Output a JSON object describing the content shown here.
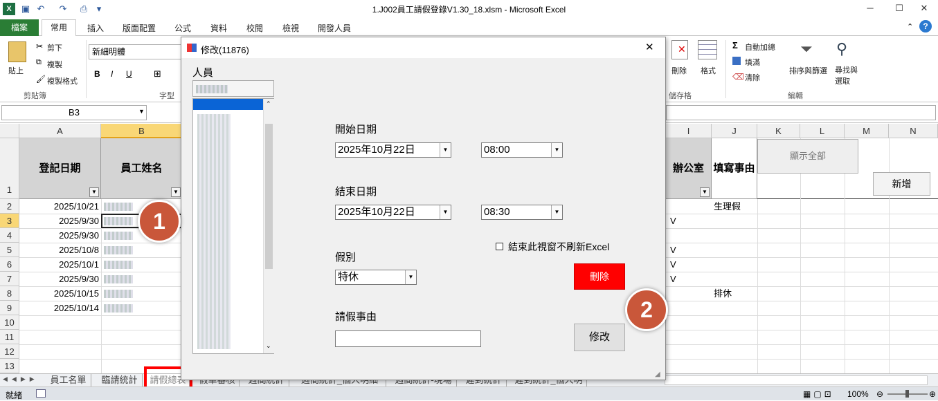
{
  "window": {
    "title": "1.J002員工請假登錄V1.30_18.xlsm - Microsoft Excel",
    "min": "─",
    "max": "☐",
    "close": "✕"
  },
  "ribbon_tabs": [
    "檔案",
    "常用",
    "插入",
    "版面配置",
    "公式",
    "資料",
    "校閱",
    "檢視",
    "開發人員"
  ],
  "ribbon": {
    "paste": "貼上",
    "cut": "剪下",
    "copy": "複製",
    "format_painter": "複製格式",
    "clipboard_group": "剪貼簿",
    "font_name": "新細明體",
    "bold": "B",
    "italic": "I",
    "underline": "U",
    "font_group": "字型",
    "delete": "刪除",
    "format": "格式",
    "cells_group": "儲存格",
    "autosum": "自動加總",
    "fill": "填滿",
    "clear": "清除",
    "sort_filter": "排序與篩選",
    "find_select": "尋找與選取",
    "editing_group": "編輯"
  },
  "formula_bar": {
    "name_box": "B3"
  },
  "columns": [
    "A",
    "B",
    "I",
    "J",
    "K",
    "L",
    "M",
    "N"
  ],
  "rows": [
    "1",
    "2",
    "3",
    "4",
    "5",
    "6",
    "7",
    "8",
    "9",
    "10",
    "11",
    "12",
    "13"
  ],
  "headers": {
    "a": "登記日期",
    "b": "員工姓名",
    "i": "辦公室",
    "j": "填寫事由"
  },
  "dates": [
    "2025/10/21",
    "2025/9/30",
    "2025/9/30",
    "2025/10/8",
    "2025/10/1",
    "2025/9/30",
    "2025/10/15",
    "2025/10/14"
  ],
  "col_i": [
    "V",
    "V",
    "V",
    "V"
  ],
  "col_j": [
    "生理假",
    "排休"
  ],
  "sheet_buttons": {
    "show_all": "顯示全部",
    "add": "新增"
  },
  "sheet_tabs": [
    "員工名單",
    "臨請統計",
    "請假總表",
    "假單審核",
    "週間統計",
    "週間統計_個人明細",
    "週間統計-現場",
    "遲到統計",
    "遲到統計_個人明"
  ],
  "status": {
    "ready": "就緒",
    "zoom": "100%"
  },
  "dialog": {
    "title": "修改(11876)",
    "close": "✕",
    "person_label": "人員",
    "start_label": "開始日期",
    "start_date": "2025年10月22日",
    "start_time": "08:00",
    "end_label": "結束日期",
    "end_date": "2025年10月22日",
    "end_time": "08:30",
    "no_refresh": "結束此視窗不刷新Excel",
    "leave_type_label": "假別",
    "leave_type": "特休",
    "delete": "刪除",
    "reason_label": "請假事由",
    "reason": "",
    "modify": "修改"
  },
  "badges": [
    "1",
    "2"
  ],
  "colors": {
    "file_tab": "#2a7d35",
    "delete_button": "#ff0000",
    "badge": "#c9573a",
    "highlight": "#ff0000"
  }
}
